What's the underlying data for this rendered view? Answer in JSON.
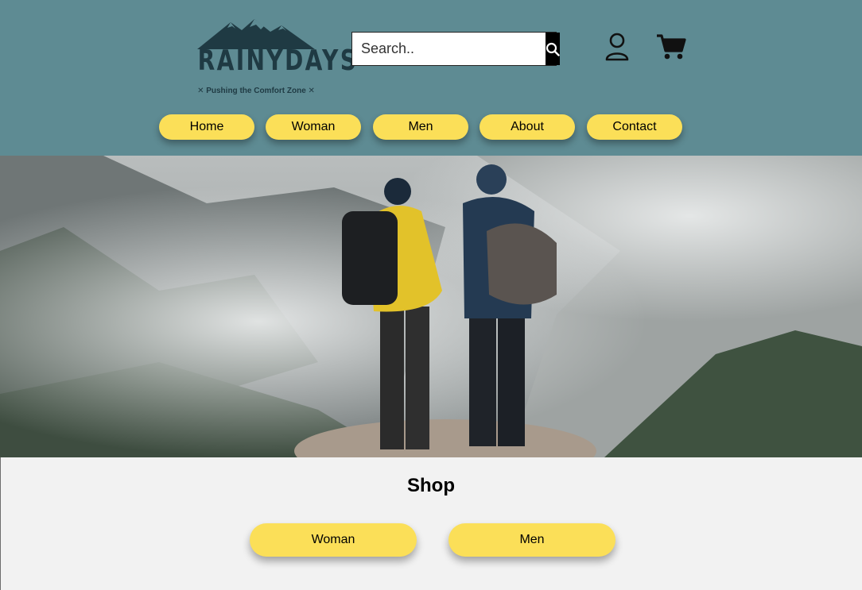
{
  "brand": {
    "name": "RAINYDAYS",
    "tagline": "✕ Pushing the Comfort Zone ✕",
    "logo_icon": "mountain-icon",
    "text_color": "#1f3a43"
  },
  "search": {
    "placeholder": "Search..",
    "button_icon": "search-icon"
  },
  "header_icons": {
    "account": "user-icon",
    "cart": "cart-icon"
  },
  "nav": {
    "items": [
      {
        "label": "Home"
      },
      {
        "label": "Woman"
      },
      {
        "label": "Men"
      },
      {
        "label": "About"
      },
      {
        "label": "Contact"
      }
    ]
  },
  "hero": {
    "alt_subject": "hikers-on-mountain-image"
  },
  "shop": {
    "title": "Shop",
    "buttons": [
      {
        "label": "Woman"
      },
      {
        "label": "Men"
      }
    ]
  },
  "colors": {
    "header_bg": "#5e8b93",
    "button_yellow": "#fbdf58",
    "page_bg": "#f2f2f2"
  }
}
